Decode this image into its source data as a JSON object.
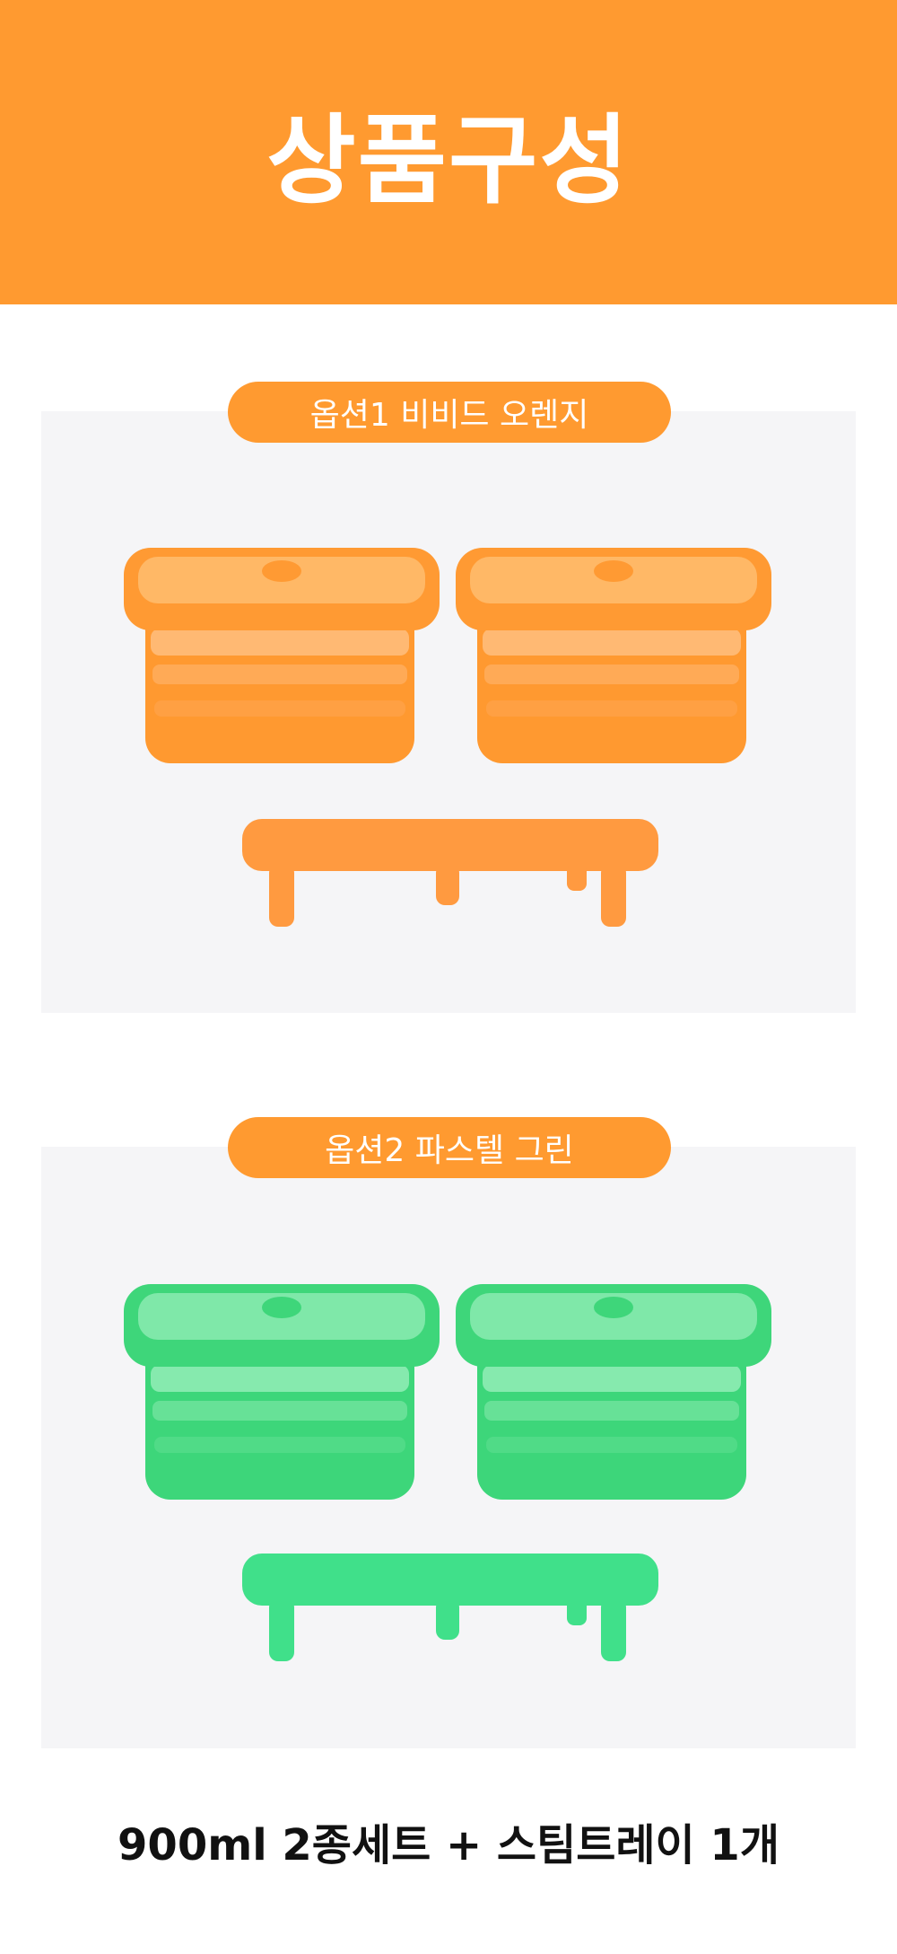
{
  "header": {
    "title": "상품구성"
  },
  "options": [
    {
      "label": "옵션1 비비드 오렌지",
      "colors": {
        "lid": "#ff9a33",
        "lidLight": "#ffb866",
        "body": "#ff9930",
        "bodyLight": "#ffc48a",
        "tray": "#ff9a40"
      }
    },
    {
      "label": "옵션2 파스텔 그린",
      "colors": {
        "lid": "#3ed67a",
        "lidLight": "#7fe8a9",
        "body": "#3dd67a",
        "bodyLight": "#9ff0c0",
        "tray": "#40e08a"
      }
    }
  ],
  "footer": {
    "text": "900ml 2종세트 + 스팀트레이 1개"
  }
}
